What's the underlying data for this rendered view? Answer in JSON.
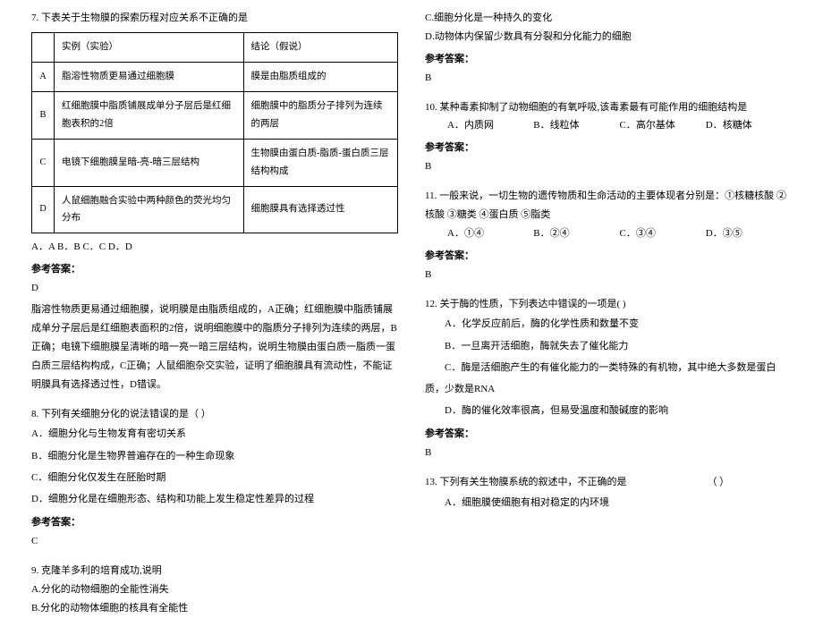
{
  "left": {
    "q7": {
      "text": "7. 下表关于生物膜的探索历程对应关系不正确的是",
      "table": {
        "header": [
          "",
          "实例（实验）",
          "结论（假说）"
        ],
        "rows": [
          [
            "A",
            "脂溶性物质更易通过细胞膜",
            "膜是由脂质组成的"
          ],
          [
            "B",
            "红细胞膜中脂质铺展成单分子层后是红细胞表积的2倍",
            "细胞膜中的脂质分子排列为连续的两层"
          ],
          [
            "C",
            "电镜下细胞膜呈暗-亮-暗三层结构",
            "生物膜由蛋白质-脂质-蛋白质三层结构构成"
          ],
          [
            "D",
            "人鼠细胞融合实验中两种颜色的荧光均匀分布",
            "细胞膜具有选择透过性"
          ]
        ]
      },
      "options": "A．A    B．B    C．C    D．D",
      "answer_label": "参考答案：",
      "answer": "D",
      "explanation": "脂溶性物质更易通过细胞膜，说明膜是由脂质组成的，A正确；红细胞膜中脂质铺展成单分子层后是红细胞表面积的2倍，说明细胞膜中的脂质分子排列为连续的两层，B正确；电镜下细胞膜呈清晰的暗一亮一暗三层结构，说明生物膜由蛋白质一脂质一蛋白质三层结构构成，C正确；人鼠细胞杂交实验，证明了细胞膜具有流动性，不能证明膜具有选择透过性，D错误。"
    },
    "q8": {
      "text": "8. 下列有关细胞分化的说法错误的是（  ）",
      "options": [
        "A．细胞分化与生物发育有密切关系",
        "B．细胞分化是生物界普遍存在的一种生命现象",
        "C．细胞分化仅发生在胚胎时期",
        "D．细胞分化是在细胞形态、结构和功能上发生稳定性差异的过程"
      ],
      "answer_label": "参考答案：",
      "answer": "C"
    },
    "q9": {
      "text": "9. 克隆羊多利的培育成功,说明",
      "options": [
        "A.分化的动物细胞的全能性消失",
        "B.分化的动物体细胞的核具有全能性"
      ]
    }
  },
  "right": {
    "q9_cont": {
      "options": [
        "C.细胞分化是一种持久的变化",
        "D.动物体内保留少数具有分裂和分化能力的细胞"
      ],
      "answer_label": "参考答案：",
      "answer": "B"
    },
    "q10": {
      "text": "10. 某种毒素抑制了动物细胞的有氧呼吸,该毒素最有可能作用的细胞结构是",
      "options": [
        "A．内质网",
        "B．线粒体",
        "C．高尔基体",
        "D．核糖体"
      ],
      "answer_label": "参考答案：",
      "answer": "B"
    },
    "q11": {
      "text": "11. 一般来说，一切生物的遗传物质和生命活动的主要体现者分别是：①核糖核酸 ②核酸 ③糖类 ④蛋白质 ⑤脂类",
      "options": [
        "A．①④",
        "B．②④",
        "C．③④",
        "D．③⑤"
      ],
      "answer_label": "参考答案：",
      "answer": "B"
    },
    "q12": {
      "text": "12. 关于酶的性质，下列表达中错误的一项是(    )",
      "options": [
        "A．化学反应前后，酶的化学性质和数量不变",
        "B．一旦离开活细胞，酶就失去了催化能力",
        "C．酶是活细胞产生的有催化能力的一类特殊的有机物，其中绝大多数是蛋白质，少数是RNA",
        "D．酶的催化效率很高，但易受温度和酸碱度的影响"
      ],
      "answer_label": "参考答案：",
      "answer": "B"
    },
    "q13": {
      "text_part1": "13. 下列有关生物膜系统的叙述中，不正确的是",
      "text_part2": "（  ）",
      "options": [
        "A．细胞膜使细胞有相对稳定的内环境"
      ]
    }
  }
}
